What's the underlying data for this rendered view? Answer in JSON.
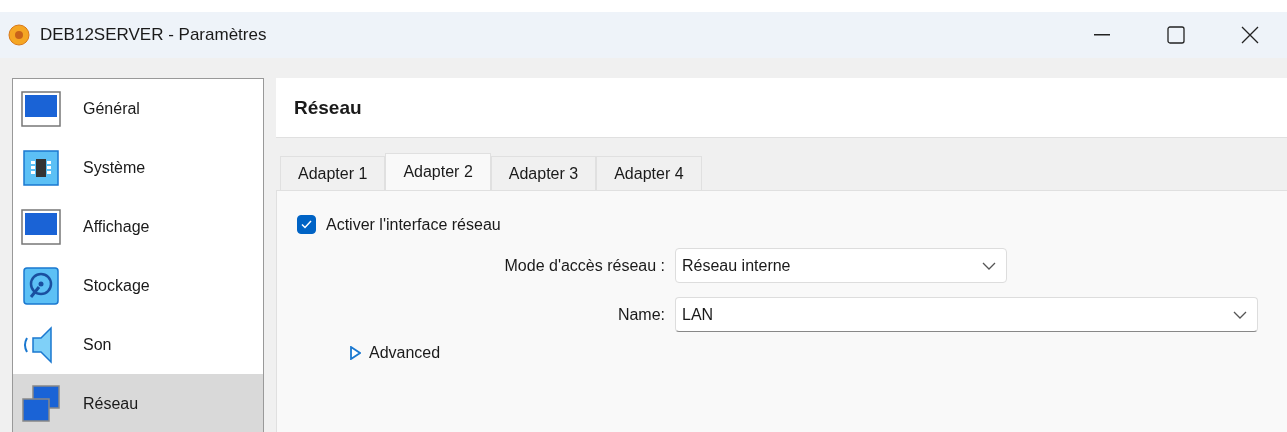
{
  "window": {
    "title": "DEB12SERVER - Paramètres"
  },
  "sidebar": {
    "items": [
      {
        "label": "Général",
        "selected": false
      },
      {
        "label": "Système",
        "selected": false
      },
      {
        "label": "Affichage",
        "selected": false
      },
      {
        "label": "Stockage",
        "selected": false
      },
      {
        "label": "Son",
        "selected": false
      },
      {
        "label": "Réseau",
        "selected": true
      }
    ]
  },
  "page": {
    "title": "Réseau"
  },
  "tabs": [
    {
      "label": "Adapter 1",
      "selected": false
    },
    {
      "label": "Adapter 2",
      "selected": true
    },
    {
      "label": "Adapter 3",
      "selected": false
    },
    {
      "label": "Adapter 4",
      "selected": false
    }
  ],
  "enable": {
    "label": "Activer l'interface réseau",
    "checked": true
  },
  "fields": [
    {
      "label": "Mode d'accès réseau :",
      "value": "Réseau interne",
      "wide": false
    },
    {
      "label": "Name:",
      "value": "LAN",
      "wide": true
    }
  ],
  "advanced": {
    "label": "Advanced",
    "expanded": false
  }
}
